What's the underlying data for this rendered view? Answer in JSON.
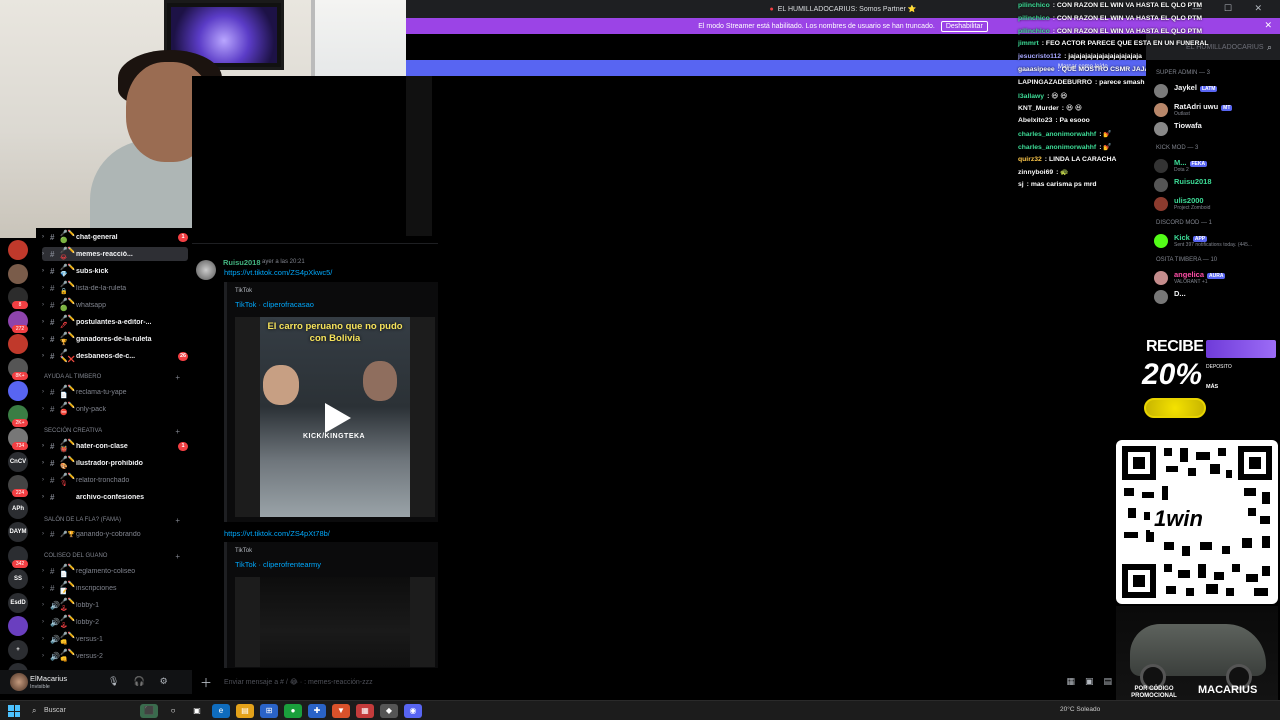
{
  "topbar": {
    "title": "EL HUMILLADOCARIUS: Somos Partner ⭐"
  },
  "streamer_banner": {
    "text": "El modo Streamer está habilitado. Los nombres de usuario se han truncado.",
    "button": "Deshabilitar"
  },
  "blue_banner": {
    "text": "Marcar como leído"
  },
  "server_header": {
    "title": "EL HUMILLADOCARIUS"
  },
  "servers": [
    {
      "label": "",
      "color": "#c0392b",
      "badge": ""
    },
    {
      "label": "",
      "color": "#7a5c4a",
      "badge": ""
    },
    {
      "label": "",
      "color": "#2c2c2c",
      "badge": "8"
    },
    {
      "label": "",
      "color": "#8e44ad",
      "badge": "272"
    },
    {
      "label": "",
      "color": "#c0392b",
      "badge": ""
    },
    {
      "label": "",
      "color": "#555",
      "badge": "8K+"
    },
    {
      "label": "",
      "color": "#5865f2",
      "badge": ""
    },
    {
      "label": "",
      "color": "#3a7d44",
      "badge": "2K+"
    },
    {
      "label": "",
      "color": "#777",
      "badge": "734"
    },
    {
      "label": "CnCV",
      "color": "#2b2d31",
      "badge": ""
    },
    {
      "label": "",
      "color": "#444",
      "badge": "224"
    },
    {
      "label": "APh",
      "color": "#2b2d31",
      "badge": ""
    },
    {
      "label": "DAYM",
      "color": "#2b2d31",
      "badge": ""
    },
    {
      "label": "",
      "color": "#2b2d31",
      "badge": "342"
    },
    {
      "label": "SS",
      "color": "#2b2d31",
      "badge": ""
    },
    {
      "label": "EsdD",
      "color": "#2b2d31",
      "badge": ""
    },
    {
      "label": "",
      "color": "#6a3fbf",
      "badge": ""
    },
    {
      "label": "+",
      "color": "#2b2d31",
      "badge": ""
    },
    {
      "label": "⌕",
      "color": "#2b2d31",
      "badge": ""
    }
  ],
  "channels": [
    {
      "name": "chat-general",
      "bold": true,
      "emoji": "🎤✏️🟢",
      "badge": "1",
      "selected": false
    },
    {
      "name": "memes-reacció...",
      "bold": true,
      "emoji": "🎤✏️😂",
      "badge": "",
      "selected": true
    },
    {
      "name": "subs-kick",
      "bold": true,
      "emoji": "🎤✏️💎",
      "badge": "",
      "selected": false
    },
    {
      "name": "lista-de-la-ruleta",
      "bold": false,
      "emoji": "🎤✏️🔒",
      "badge": "",
      "selected": false
    },
    {
      "name": "whatsapp",
      "bold": false,
      "emoji": "🎤✏️🟢",
      "badge": "",
      "selected": false
    },
    {
      "name": "postulantes-a-editor-...",
      "bold": true,
      "emoji": "🎤✏️🖊",
      "badge": "",
      "selected": false
    },
    {
      "name": "ganadores-de-la-ruleta",
      "bold": true,
      "emoji": "🎤✏️🏆",
      "badge": "",
      "selected": false
    },
    {
      "name": "desbaneos-de-c...",
      "bold": true,
      "emoji": "🎤✏️❌",
      "badge": "26",
      "selected": false
    }
  ],
  "channels_ayuda": {
    "category": "AYUDA AL TIMBERO",
    "items": [
      {
        "name": "reclama-tu-yape",
        "bold": false,
        "emoji": "🎤✏️📄"
      },
      {
        "name": "only-pack",
        "bold": false,
        "emoji": "🎤✏️⛔"
      }
    ]
  },
  "channels_creativa": {
    "category": "SECCIÓN CREATIVA",
    "items": [
      {
        "name": "hater-con-clase",
        "bold": true,
        "emoji": "🎤✏️👹",
        "badge": "1"
      },
      {
        "name": "ilustrador-prohibido",
        "bold": true,
        "emoji": "🎤✏️🎨",
        "badge": ""
      },
      {
        "name": "relator-tronchado",
        "bold": false,
        "emoji": "🎤✏️🎙",
        "badge": ""
      }
    ]
  },
  "channel_archivo": "archivo-confesiones",
  "channels_salon": {
    "category": "SALÓN DE LA FLA? (FAMA)",
    "items": [
      {
        "name": "ganando-y-cobrando",
        "emoji": "🎤🏆"
      }
    ]
  },
  "channels_coliseo": {
    "category": "COLISEO DEL GUANO",
    "items": [
      {
        "name": "reglamento-coliseo",
        "emoji": "🎤✏️📄",
        "voice": false
      },
      {
        "name": "inscripciones",
        "emoji": "🎤✏️📝",
        "voice": false
      },
      {
        "name": "lobby-1",
        "emoji": "🎤✏️🕹",
        "voice": true
      },
      {
        "name": "lobby-2",
        "emoji": "🎤✏️🕹",
        "voice": true
      },
      {
        "name": "versus-1",
        "emoji": "🎤✏️👊",
        "voice": true
      },
      {
        "name": "versus-2",
        "emoji": "🎤✏️👊",
        "voice": true
      }
    ]
  },
  "user_panel": {
    "name": "ElMacarius",
    "status": "Invisible"
  },
  "message": {
    "author": "Ruisu2018",
    "time": "ayer a las 20:21",
    "link1": "https://vt.tiktok.com/ZS4pXkwc5/",
    "embed1": {
      "provider": "TikTok",
      "title": "TikTok · cliperofracasao",
      "caption": "El carro peruano que no pudo con Bolivia",
      "watermark": "KICK/KINGTEKA"
    },
    "link2": "https://vt.tiktok.com/ZS4pXt78b/",
    "embed2": {
      "provider": "TikTok",
      "title": "TikTok · cliperofrentearmy"
    }
  },
  "composer": {
    "placeholder": "Enviar mensaje a # / 😂 · : memes-reacción-zzz"
  },
  "chat_overlay": [
    {
      "user": "pilinchico",
      "color": "#3ddc97",
      "text": ": CON RAZON EL WIN VA HASTA EL QLO PTM"
    },
    {
      "user": "pilinchico",
      "color": "#3ddc97",
      "text": ": CON RAZON EL WIN VA HASTA EL QLO PTM"
    },
    {
      "user": "pilinchico",
      "color": "#3ddc97",
      "text": ": CON RAZON EL WIN VA HASTA EL QLO PTM"
    },
    {
      "user": "jimmrt",
      "color": "#3ddc97",
      "text": ": FEO ACTOR PARECE QUE ESTA EN UN FUNERAL"
    },
    {
      "user": "jesucristo112",
      "color": "#a7a7ff",
      "text": ": jajajajajajajajajajajajaja"
    },
    {
      "user": "gaaasipeee",
      "color": "#f6f6f6",
      "text": ": QUE MOSTRO CSMR JAJAJA xd"
    },
    {
      "user": "LAPINGAZADEBURRO",
      "color": "#f6f6f6",
      "text": ": parece smash con cemento"
    },
    {
      "user": "l3allawy",
      "color": "#3ddc97",
      "text": ": 😆 😆"
    },
    {
      "user": "KNT_Murder",
      "color": "#f6f6f6",
      "text": ": 😆 😆"
    },
    {
      "user": "Abelxito23",
      "color": "#f6f6f6",
      "text": ": Pa esooo"
    },
    {
      "user": "charles_anonimorwahhf",
      "color": "#3ddc97",
      "text": ": 💅"
    },
    {
      "user": "charles_anonimorwahhf",
      "color": "#3ddc97",
      "text": ": 💅"
    },
    {
      "user": "quirz32",
      "color": "#ffc94a",
      "text": ": LINDA LA CARACHA"
    },
    {
      "user": "zinnyboi69",
      "color": "#f6f6f6",
      "text": ": 🐢"
    },
    {
      "user": "sj",
      "color": "#f6f6f6",
      "text": ": mas carisma ps mrd"
    }
  ],
  "members": {
    "cat1": "SUPER ADMIN — 3",
    "list1": [
      {
        "name": "Jaykel",
        "tag": "LATM",
        "sub": "",
        "color": "#f2f3f5",
        "av": "#7b7b7b"
      },
      {
        "name": "RatAdri uwu",
        "tag": "MT",
        "sub": "Outlast",
        "color": "#f2f3f5",
        "av": "#b8876a"
      },
      {
        "name": "Tiowafa",
        "tag": "",
        "sub": "",
        "color": "#f2f3f5",
        "av": "#888"
      }
    ],
    "cat2": "KICK MOD — 3",
    "list2": [
      {
        "name": "M...",
        "tag": "FEKA",
        "sub": "Dota 2",
        "color": "#3ddc97",
        "av": "#333"
      },
      {
        "name": "Ruisu2018",
        "tag": "",
        "sub": "",
        "color": "#3ddc97",
        "av": "#555"
      },
      {
        "name": "ulis2000",
        "tag": "",
        "sub": "Project Zomboid",
        "color": "#3ddc97",
        "av": "#8c3b2e"
      }
    ],
    "cat3": "DISCORD MOD — 1",
    "list3": [
      {
        "name": "Kick",
        "tag": "APP",
        "sub": "Sent 397 notifications today. (445...",
        "color": "#3ddc97",
        "av": "#53fc18"
      }
    ],
    "cat4": "OSITA TIMBERA — 10",
    "list4": [
      {
        "name": "angelica",
        "tag": "AURA",
        "sub": "VALORANT +1",
        "color": "#ff4fa8",
        "av": "#c48c8c"
      },
      {
        "name": "D...",
        "tag": "",
        "sub": "",
        "color": "#f2f3f5",
        "av": "#777"
      }
    ]
  },
  "promo": {
    "recibe": "RECIBE",
    "percent": "20%",
    "mas": "MÁS",
    "deposito": "DEPOSITO",
    "brand": "1win",
    "codigo": "POR CÓDIGO PROMOCIONAL",
    "code": "MACARIUS"
  },
  "taskbar": {
    "search": "Buscar",
    "weather": "20°C Soleado",
    "apps": [
      {
        "icon": "⬛",
        "color": "#3a6b4d"
      },
      {
        "icon": "○",
        "color": "#1c1c1c"
      },
      {
        "icon": "▣",
        "color": "#1c1c1c"
      },
      {
        "icon": "e",
        "color": "#0f6cbd"
      },
      {
        "icon": "▤",
        "color": "#e3a21a"
      },
      {
        "icon": "⊞",
        "color": "#2a63c7"
      },
      {
        "icon": "●",
        "color": "#1a9f3c"
      },
      {
        "icon": "✚",
        "color": "#2a63c7"
      },
      {
        "icon": "▼",
        "color": "#d9522b"
      },
      {
        "icon": "▦",
        "color": "#c43b3b"
      },
      {
        "icon": "◆",
        "color": "#555"
      },
      {
        "icon": "◉",
        "color": "#5865f2"
      }
    ]
  }
}
